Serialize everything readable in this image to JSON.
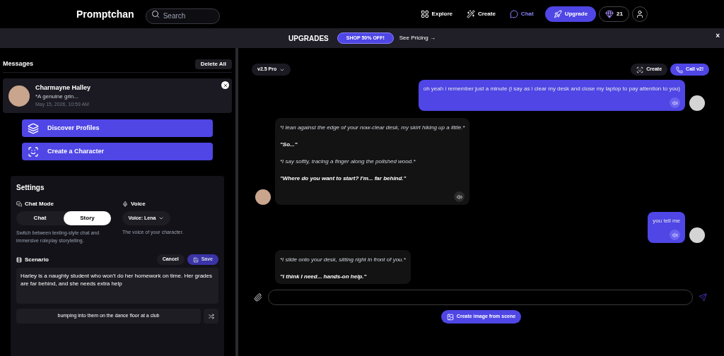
{
  "header": {
    "logo": "Promptchan",
    "search": {
      "placeholder": "Search"
    },
    "nav": [
      {
        "label": "Explore",
        "kind": "grid",
        "selected": false
      },
      {
        "label": "Create",
        "kind": "wand",
        "selected": false
      },
      {
        "label": "Chat",
        "kind": "chat",
        "selected": true
      }
    ],
    "upgrade": "Upgrade",
    "gems": "21"
  },
  "banner": {
    "title": "UPGRADES",
    "cta": "SHOP 50% OFF!",
    "link": "See Pricing →",
    "close": "×"
  },
  "sidebar": {
    "title": "Messages",
    "delete_all": "Delete All",
    "conversations": [
      {
        "name": "Charmayne Halley",
        "preview": "*A genuine grin...",
        "time": "May 15, 2026, 10:59 AM"
      }
    ],
    "actions": [
      {
        "label": "Discover Profiles",
        "kind": "cards"
      },
      {
        "label": "Create a Character",
        "kind": "scan"
      }
    ],
    "settings": {
      "title": "Settings",
      "chat_mode": {
        "label": "Chat Mode",
        "options": [
          {
            "label": "Chat",
            "selected": false
          },
          {
            "label": "Story",
            "selected": true
          }
        ],
        "help": "Switch between texting-style chat and immersive roleplay storytelling."
      },
      "voice": {
        "label": "Voice",
        "value": "Voice: Lena",
        "help": "The voice of your character."
      },
      "scenario": {
        "label": "Scenario",
        "cancel": "Cancel",
        "save": "Save",
        "save_disabled": true,
        "value": "Harley is a naughty student who won't do her homework on time. Her grades are far behind, and she needs extra help",
        "suggestion": "bumping into them on the dance floor at a club"
      }
    }
  },
  "chat": {
    "model": "v2.5 Pro",
    "create": "Create",
    "call": "Call v2!",
    "messages": [
      {
        "kind": "user",
        "lines": [
          {
            "kind": "plain",
            "text": "oh yeah i remember just a minute (i say as i clear my desk and close my laptop to pay attention to you)"
          }
        ]
      },
      {
        "kind": "bot",
        "cut": false,
        "lines": [
          {
            "kind": "action",
            "text": "*I lean against the edge of your now-clear desk, my skirt hiking up a little.*"
          },
          {
            "kind": "speech",
            "text": "\"So...\""
          },
          {
            "kind": "action",
            "text": "*I say softly, tracing a finger along the polished wood.*"
          },
          {
            "kind": "speech",
            "text": "\"Where do you want to start? I'm... far behind.\""
          }
        ]
      },
      {
        "kind": "user",
        "lines": [
          {
            "kind": "plain",
            "text": "you tell me"
          }
        ]
      },
      {
        "kind": "bot",
        "cut": true,
        "lines": [
          {
            "kind": "action",
            "text": "*I slide onto your desk, sitting right in front of you.*"
          },
          {
            "kind": "speech",
            "text": "\"I think I need... hands-on help.\""
          }
        ]
      }
    ],
    "scene_button": "Create image from scene"
  }
}
